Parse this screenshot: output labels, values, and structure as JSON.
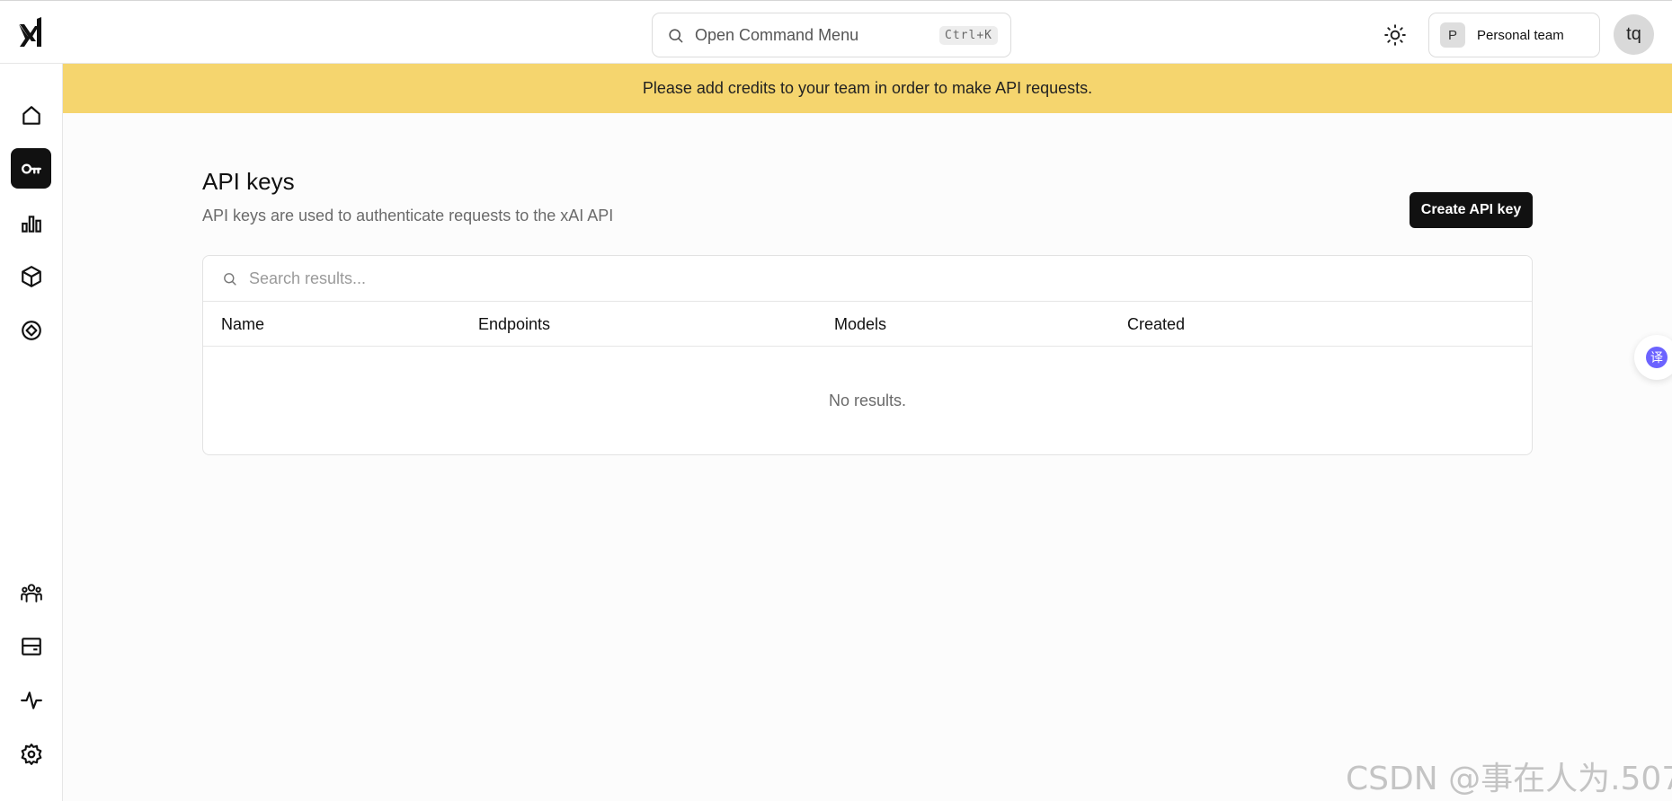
{
  "header": {
    "command_menu_label": "Open Command Menu",
    "command_menu_shortcut": "Ctrl+K",
    "team_initial": "P",
    "team_name": "Personal team",
    "user_initials": "tq"
  },
  "sidebar": {
    "top_items": [
      {
        "icon": "home-icon",
        "active": false
      },
      {
        "icon": "key-icon",
        "active": true
      },
      {
        "icon": "bar-chart-icon",
        "active": false
      },
      {
        "icon": "cube-icon",
        "active": false
      },
      {
        "icon": "compass-icon",
        "active": false
      }
    ],
    "bottom_items": [
      {
        "icon": "users-icon"
      },
      {
        "icon": "billing-icon"
      },
      {
        "icon": "activity-icon"
      },
      {
        "icon": "settings-icon"
      }
    ]
  },
  "banner": {
    "text": "Please add credits to your team in order to make API requests.",
    "color": "#f5d56e"
  },
  "main": {
    "title": "API keys",
    "subtitle": "API keys are used to authenticate requests to the xAI API",
    "create_button": "Create API key",
    "search_placeholder": "Search results...",
    "columns": [
      "Name",
      "Endpoints",
      "Models",
      "Created"
    ],
    "empty_text": "No results."
  },
  "floating": {
    "translate_glyph": "译"
  },
  "watermark": "CSDN @事在人为.507"
}
